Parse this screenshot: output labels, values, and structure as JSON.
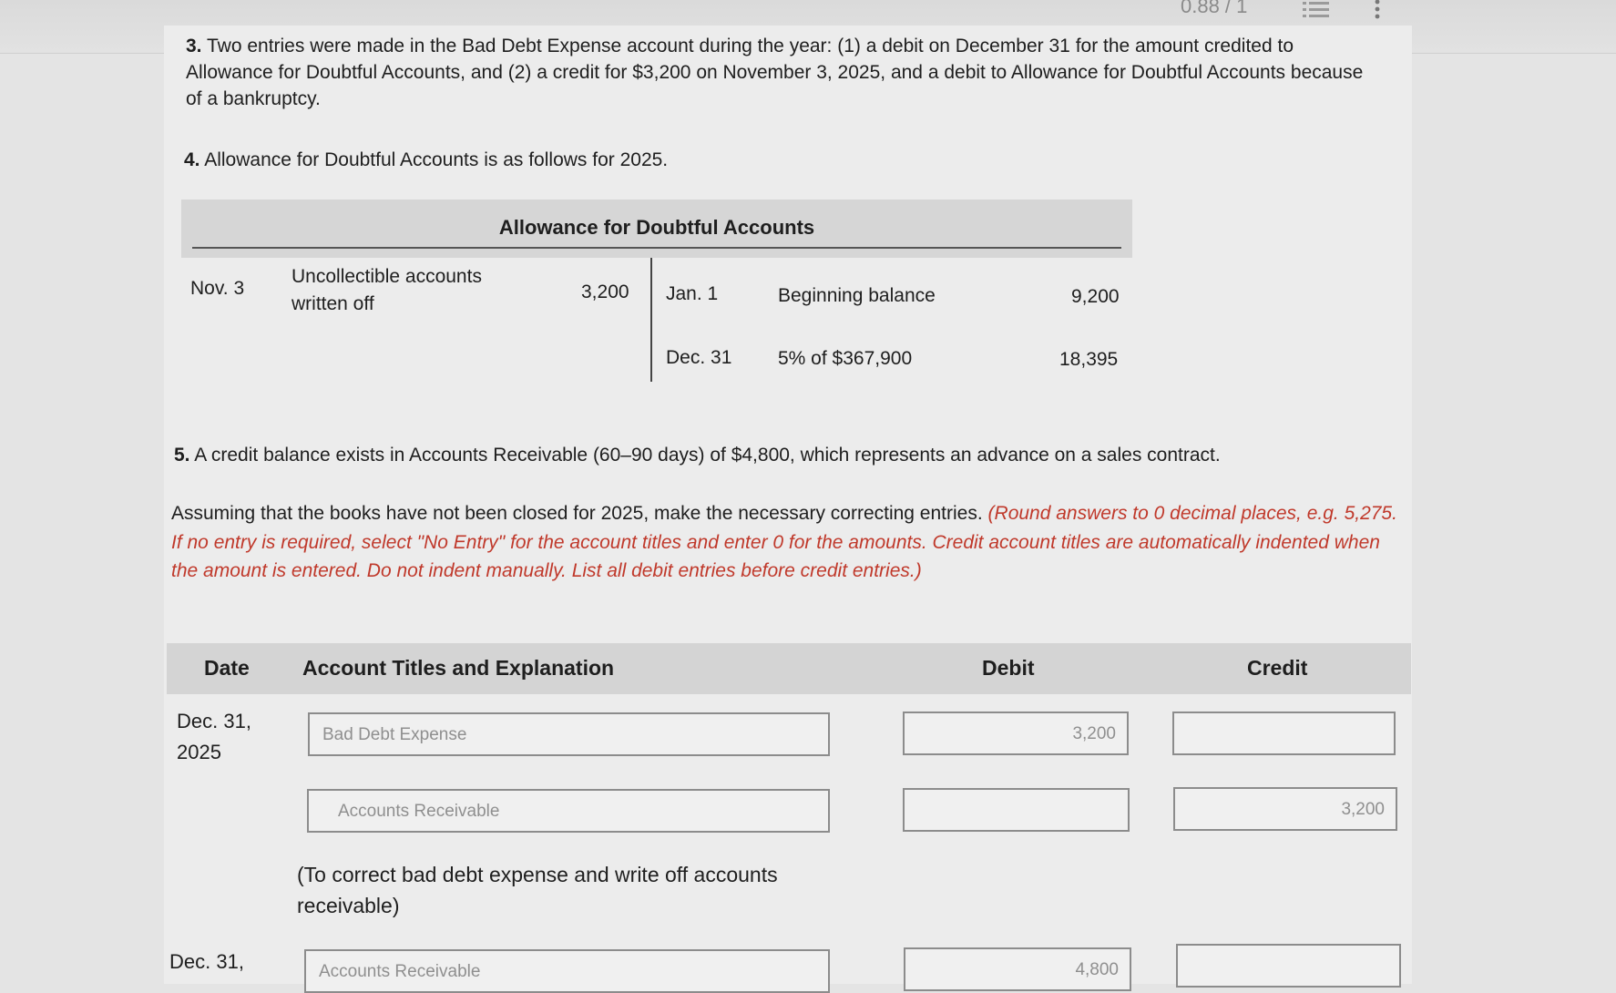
{
  "header": {
    "progress": "0.88 / 1"
  },
  "item3": {
    "number": "3.",
    "text": "Two entries were made in the Bad Debt Expense account during the year: (1) a debit on December 31 for the amount credited to Allowance for Doubtful Accounts, and (2) a credit for $3,200 on November 3, 2025, and a debit to Allowance for Doubtful Accounts because of a bankruptcy."
  },
  "item4": {
    "number": "4.",
    "text": "Allowance for Doubtful Accounts is as follows for 2025."
  },
  "taccount": {
    "title": "Allowance for Doubtful Accounts",
    "debit": {
      "date": "Nov. 3",
      "desc_line1": "Uncollectible accounts",
      "desc_line2": "written off",
      "amount": "3,200"
    },
    "credits": [
      {
        "date": "Jan. 1",
        "desc": "Beginning balance",
        "amount": "9,200"
      },
      {
        "date": "Dec. 31",
        "desc": "5% of $367,900",
        "amount": "18,395"
      }
    ]
  },
  "item5": {
    "number": "5.",
    "text": "A credit balance exists in Accounts Receivable (60–90 days) of $4,800, which represents an advance on a sales contract."
  },
  "instructions": {
    "main": "Assuming that the books have not been closed for 2025, make the necessary correcting entries.",
    "hint": "(Round answers to 0 decimal places, e.g. 5,275. If no entry is required, select \"No Entry\" for the account titles and enter 0 for the amounts. Credit account titles are automatically indented when the amount is entered. Do not indent manually. List all debit entries before credit entries.)"
  },
  "journal": {
    "headers": {
      "date": "Date",
      "account": "Account Titles and Explanation",
      "debit": "Debit",
      "credit": "Credit"
    },
    "entry1": {
      "date_line1": "Dec. 31,",
      "date_line2": "2025",
      "rows": [
        {
          "account": "Bad Debt Expense",
          "debit": "3,200",
          "credit": ""
        },
        {
          "account": "Accounts Receivable",
          "debit": "",
          "credit": "3,200"
        }
      ],
      "explanation": "(To correct bad debt expense and write off accounts receivable)"
    },
    "entry2": {
      "date_line1": "Dec. 31,",
      "rows": [
        {
          "account": "Accounts Receivable",
          "debit": "4,800",
          "credit": ""
        }
      ]
    }
  }
}
